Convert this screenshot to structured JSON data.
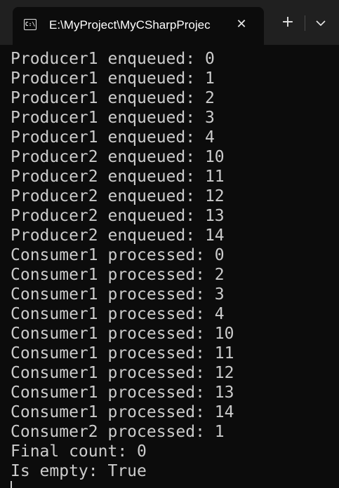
{
  "tab": {
    "icon": "console-icon",
    "title": "E:\\MyProject\\MyCSharpProjec",
    "close_icon": "close-icon"
  },
  "toolbar": {
    "new_tab_icon": "plus-icon",
    "dropdown_icon": "chevron-down-icon"
  },
  "console": {
    "lines": [
      "Producer1 enqueued: 0",
      "Producer1 enqueued: 1",
      "Producer1 enqueued: 2",
      "Producer1 enqueued: 3",
      "Producer1 enqueued: 4",
      "Producer2 enqueued: 10",
      "Producer2 enqueued: 11",
      "Producer2 enqueued: 12",
      "Producer2 enqueued: 13",
      "Producer2 enqueued: 14",
      "Consumer1 processed: 0",
      "Consumer1 processed: 2",
      "Consumer1 processed: 3",
      "Consumer1 processed: 4",
      "Consumer1 processed: 10",
      "Consumer1 processed: 11",
      "Consumer1 processed: 12",
      "Consumer1 processed: 13",
      "Consumer1 processed: 14",
      "Consumer2 processed: 1",
      "Final count: 0",
      "Is empty: True"
    ]
  },
  "colors": {
    "background": "#0c0c0c",
    "tabbar": "#202020",
    "text": "#cccccc",
    "title_text": "#ffffff"
  }
}
